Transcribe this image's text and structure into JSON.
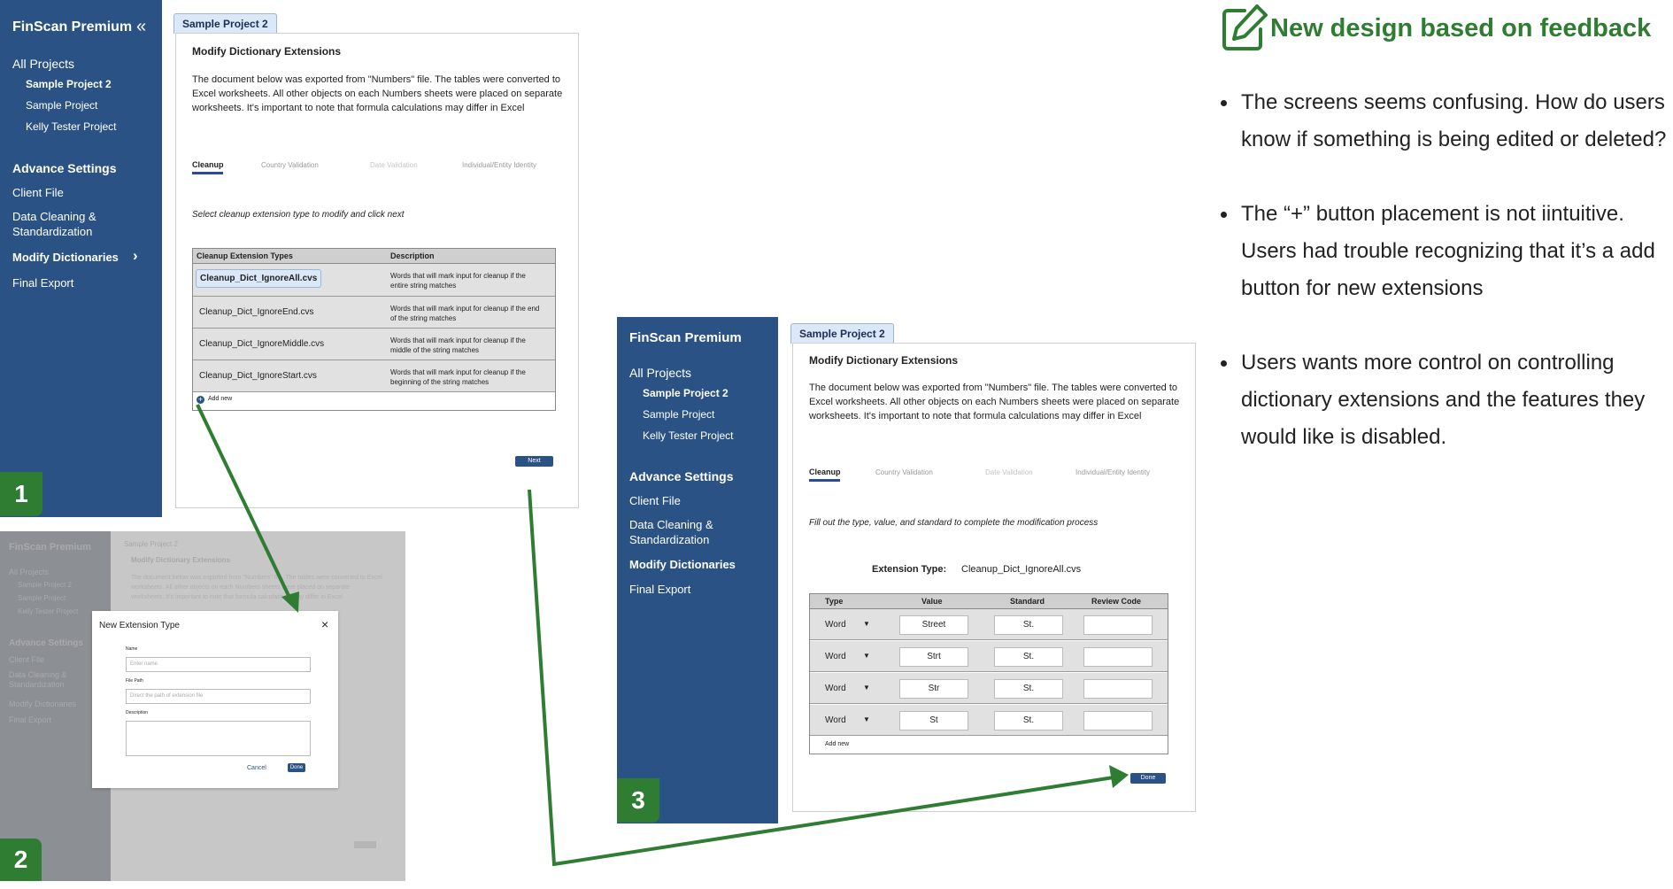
{
  "app": {
    "title": "FinScan Premium",
    "collapse_icon": "«",
    "nav": {
      "all_projects": "All Projects",
      "projects": [
        "Sample Project 2",
        "Sample Project",
        "Kelly Tester Project"
      ],
      "advance_settings": "Advance Settings",
      "client_file": "Client File",
      "data_cleaning": "Data Cleaning & Standardization",
      "modify_dictionaries": "Modify Dictionaries",
      "final_export": "Final Export"
    },
    "project_tab": "Sample Project 2",
    "page_heading": "Modify Dictionary Extensions",
    "intro": "The document below was exported from \"Numbers\" file. The tables were converted to Excel worksheets. All other objects on each Numbers sheets were placed on separate worksheets. It's important to note that formula calculations may differ in Excel",
    "subtabs": [
      "Cleanup",
      "Country Validation",
      "Date Validation",
      "Individual/Entity Identity"
    ]
  },
  "screen1": {
    "badge": "1",
    "instruction": "Select cleanup extension type to modify and click next",
    "table_headers": [
      "Cleanup Extension Types",
      "Description"
    ],
    "rows": [
      {
        "name": "Cleanup_Dict_IgnoreAll.cvs",
        "desc": "Words that will mark input for cleanup if the entire string matches"
      },
      {
        "name": "Cleanup_Dict_IgnoreEnd.cvs",
        "desc": "Words that will mark input for cleanup if the end of the string matches"
      },
      {
        "name": "Cleanup_Dict_IgnoreMiddle.cvs",
        "desc": "Words that will mark input for cleanup if the middle of the string matches"
      },
      {
        "name": "Cleanup_Dict_IgnoreStart.cvs",
        "desc": "Words that will mark input for cleanup if the beginning of the string matches"
      }
    ],
    "add_new": "Add new",
    "next_button": "Next"
  },
  "screen2": {
    "badge": "2",
    "modal": {
      "title": "New Extension Type",
      "close": "×",
      "name_label": "Name",
      "name_placeholder": "Enter name",
      "path_label": "File Path",
      "path_placeholder": "Direct the path of extension file",
      "desc_label": "Description",
      "cancel": "Cancel",
      "done": "Done"
    }
  },
  "screen3": {
    "badge": "3",
    "instruction": "Fill out the type, value, and standard to complete the modification process",
    "ext_type_label": "Extension Type:",
    "ext_type_value": "Cleanup_Dict_IgnoreAll.cvs",
    "table_headers": [
      "Type",
      "Value",
      "Standard",
      "Review Code"
    ],
    "rows": [
      {
        "type": "Word",
        "value": "Street",
        "standard": "St."
      },
      {
        "type": "Word",
        "value": "Strt",
        "standard": "St."
      },
      {
        "type": "Word",
        "value": "Str",
        "standard": "St."
      },
      {
        "type": "Word",
        "value": "St",
        "standard": "St."
      }
    ],
    "add_new": "Add new",
    "done_button": "Done"
  },
  "feedback": {
    "icon": "edit-pencil-icon",
    "title": "New design based on feedback",
    "color": "#2e7d32",
    "bullets": [
      "The screens seems confusing. How do users know if something is being edited or deleted?",
      "The “+” button placement is not iintuitive. Users had trouble recognizing that it’s a add button for new extensions",
      "Users wants more control on controlling dictionary extensions and the features they would like is disabled."
    ]
  }
}
